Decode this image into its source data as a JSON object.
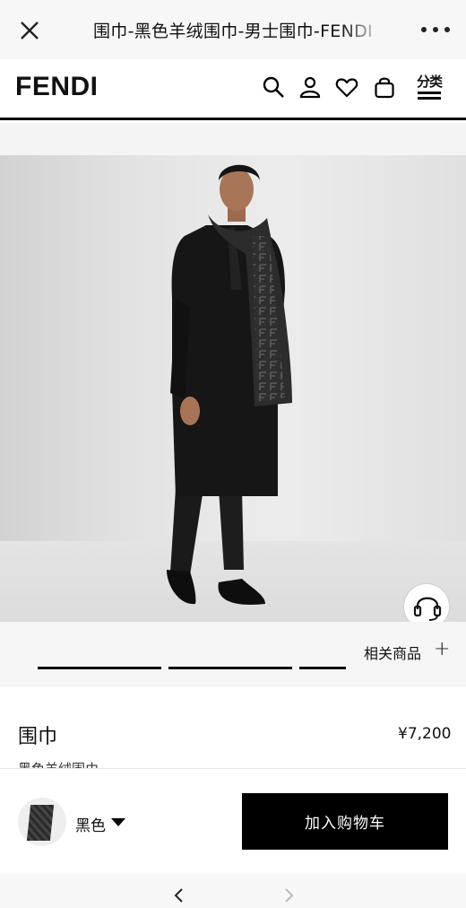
{
  "window": {
    "title": "围巾-黑色羊绒围巾-男士围巾-FENDI"
  },
  "header": {
    "logo": "FENDI",
    "menu_label": "分类"
  },
  "gallery": {
    "related_label": "相关商品",
    "related_toggle": "+"
  },
  "product": {
    "name": "围巾",
    "price": "¥7,200",
    "subtitle": "黑色羊绒围巾"
  },
  "purchase": {
    "color_selected": "黑色",
    "add_to_cart": "加入购物车"
  },
  "colors": {
    "accent": "#000000",
    "background": "#ffffff",
    "band": "#f5f5f5"
  }
}
